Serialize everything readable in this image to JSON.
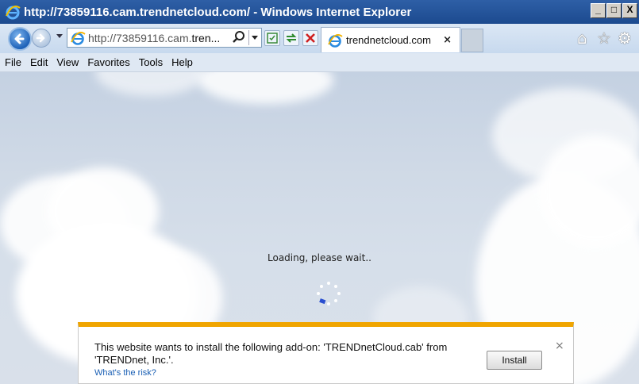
{
  "window": {
    "title": "http://73859116.cam.trendnetcloud.com/ - Windows Internet Explorer",
    "controls": {
      "minimize": "_",
      "maximize": "□",
      "close": "X"
    }
  },
  "nav": {
    "address_prefix": "http://73859116.cam.",
    "address_host": "tren...",
    "tab_label": "trendnetcloud.com",
    "tab_close": "×"
  },
  "menu": {
    "items": [
      "File",
      "Edit",
      "View",
      "Favorites",
      "Tools",
      "Help"
    ]
  },
  "content": {
    "loading_text": "Loading, please wait.."
  },
  "infobar": {
    "message": "This website wants to install the following add-on: 'TRENDnetCloud.cab' from 'TRENDnet, Inc.'.",
    "link": "What's the risk?",
    "install_label": "Install",
    "close": "×"
  },
  "icons": {
    "title_ie": "ie-logo-icon",
    "back": "back-arrow-icon",
    "forward": "forward-arrow-icon",
    "search": "search-icon",
    "compatibility": "compatibility-view-icon",
    "refresh": "refresh-icon",
    "stop": "stop-icon",
    "home": "home-icon",
    "favorites": "star-icon",
    "tools": "gear-icon"
  },
  "colors": {
    "titlebar": "#1c4a8f",
    "infobar_accent": "#f0a500",
    "link": "#1a5fb4"
  }
}
